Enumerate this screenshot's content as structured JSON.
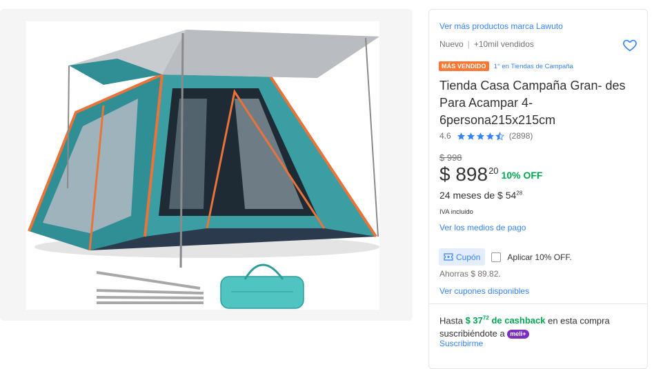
{
  "product": {
    "brand_link": "Ver más productos marca Lawuto",
    "condition": "Nuevo",
    "sold": "+10mil vendidos",
    "badge": "MÁS VENDIDO",
    "ranking": "1° en Tiendas de Campaña",
    "title": "Tienda Casa Campaña Gran- des Para Acampar 4- 6persona215x215cm",
    "rating": "4.6",
    "rating_fraction": 0.92,
    "reviews": "(2898)",
    "old_price": "$ 998",
    "price_main": "$ 898",
    "price_cents": "20",
    "discount": "10% OFF",
    "installments_prefix": "24 meses de $ 54",
    "installments_cents": "28",
    "tax_note": "IVA incluido",
    "payment_link": "Ver los medios de pago",
    "coupon_label": "Cupón",
    "coupon_apply": "Aplicar 10% OFF.",
    "savings": "Ahorras $ 89.82.",
    "coupons_link": "Ver cupones disponibles",
    "cashback_prefix": "Hasta",
    "cashback_amount": "$ 37",
    "cashback_cents": "72",
    "cashback_label": "de cashback",
    "cashback_suffix": "en esta compra suscribiéndote a",
    "meli_badge": "meli+",
    "subscribe_link": "Suscribirme"
  },
  "icons": {
    "favorite": "heart-icon",
    "star": "star-icon",
    "coupon": "ticket-icon"
  },
  "colors": {
    "link": "#3483fa",
    "badge": "#ff7733",
    "discount": "#00a650",
    "meli": "#7b2fbf",
    "tent_teal": "#2f8f95",
    "tent_orange": "#e8743a",
    "bag_teal": "#4fc4c0"
  }
}
